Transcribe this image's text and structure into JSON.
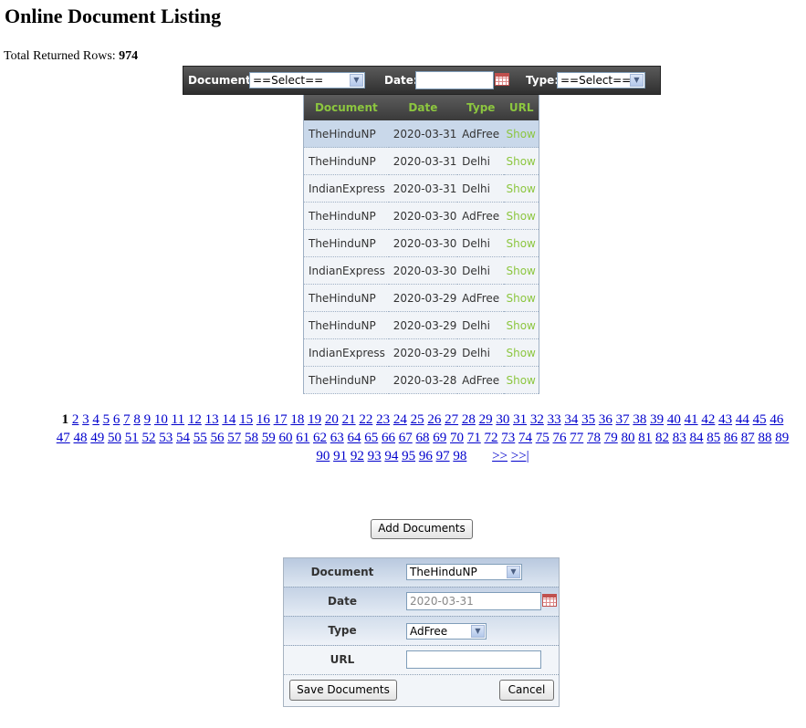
{
  "page": {
    "title": "Online Document Listing",
    "total_label": "Total Returned Rows:",
    "total_value": "974"
  },
  "filters": {
    "document_label": "Document:",
    "document_value": "==Select==",
    "date_label": "Date:",
    "date_value": "",
    "type_label": "Type:",
    "type_value": "==Select=="
  },
  "listing": {
    "headers": [
      "Document",
      "Date",
      "Type",
      "URL"
    ],
    "rows": [
      {
        "document": "TheHinduNP",
        "date": "2020-03-31",
        "type": "AdFree",
        "url": "Show"
      },
      {
        "document": "TheHinduNP",
        "date": "2020-03-31",
        "type": "Delhi",
        "url": "Show"
      },
      {
        "document": "IndianExpress",
        "date": "2020-03-31",
        "type": "Delhi",
        "url": "Show"
      },
      {
        "document": "TheHinduNP",
        "date": "2020-03-30",
        "type": "AdFree",
        "url": "Show"
      },
      {
        "document": "TheHinduNP",
        "date": "2020-03-30",
        "type": "Delhi",
        "url": "Show"
      },
      {
        "document": "IndianExpress",
        "date": "2020-03-30",
        "type": "Delhi",
        "url": "Show"
      },
      {
        "document": "TheHinduNP",
        "date": "2020-03-29",
        "type": "AdFree",
        "url": "Show"
      },
      {
        "document": "TheHinduNP",
        "date": "2020-03-29",
        "type": "Delhi",
        "url": "Show"
      },
      {
        "document": "IndianExpress",
        "date": "2020-03-29",
        "type": "Delhi",
        "url": "Show"
      },
      {
        "document": "TheHinduNP",
        "date": "2020-03-28",
        "type": "AdFree",
        "url": "Show"
      }
    ]
  },
  "pager": {
    "current": "1",
    "last_page": 98,
    "next_label": ">>",
    "last_label": ">>|"
  },
  "add_button_label": "Add Documents",
  "add_form": {
    "document_label": "Document",
    "document_value": "TheHinduNP",
    "date_label": "Date",
    "date_value": "2020-03-31",
    "type_label": "Type",
    "type_value": "AdFree",
    "url_label": "URL",
    "url_value": "",
    "save_label": "Save Documents",
    "cancel_label": "Cancel"
  }
}
